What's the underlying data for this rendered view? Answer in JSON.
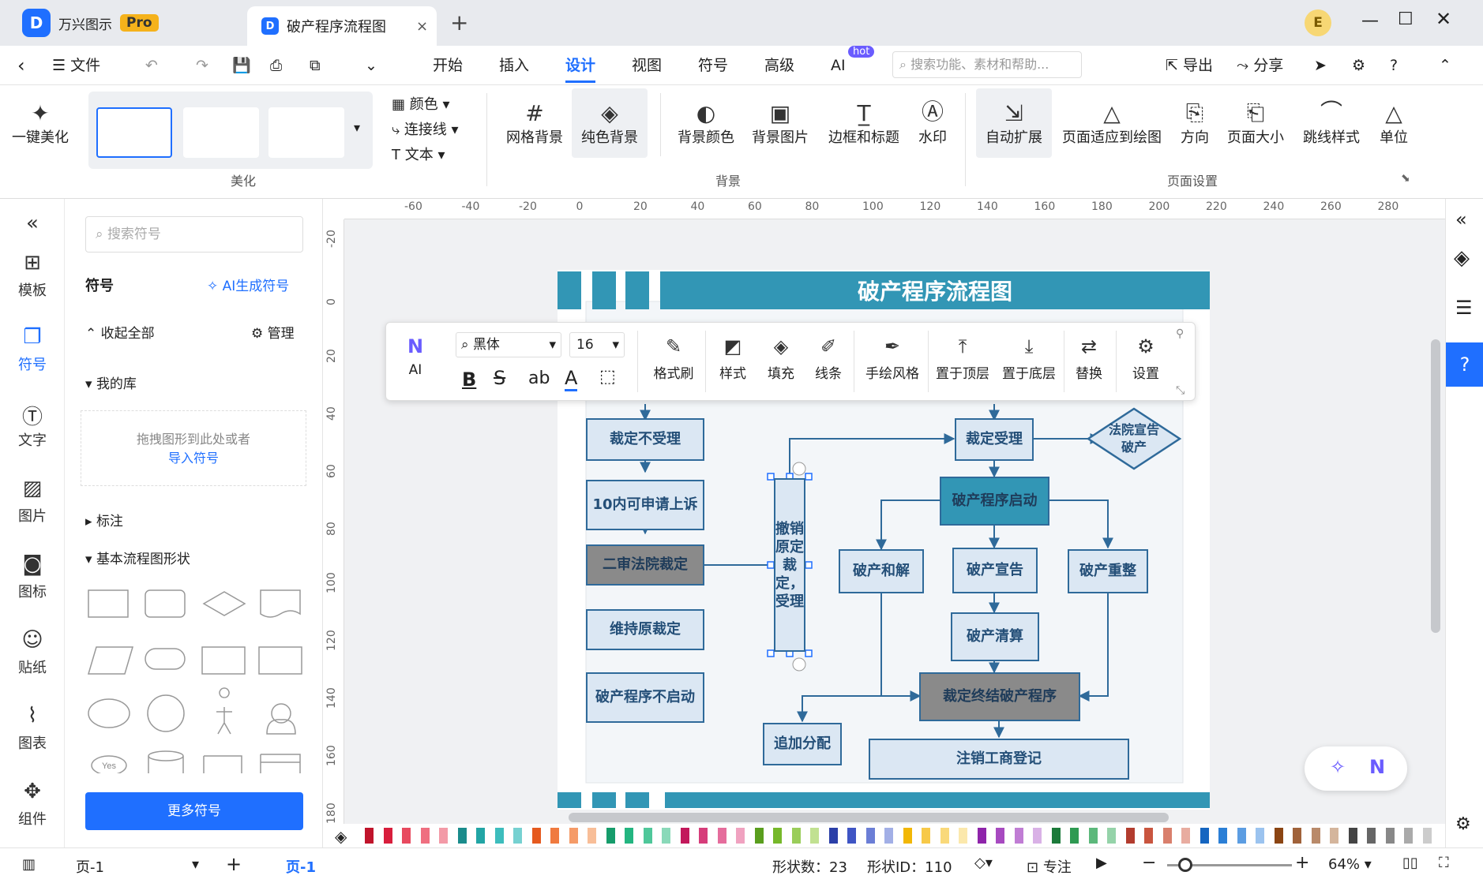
{
  "app": {
    "name": "万兴图示",
    "badge": "Pro",
    "doc_tab": "破产程序流程图",
    "new_tab": "+",
    "close_tab": "×",
    "user_initial": "E"
  },
  "menu": {
    "file": "文件",
    "tabs": [
      "开始",
      "插入",
      "设计",
      "视图",
      "符号",
      "高级",
      "AI"
    ],
    "active_tab": "设计",
    "ai_badge": "hot",
    "search_placeholder": "搜索功能、素材和帮助...",
    "export": "导出",
    "share": "分享"
  },
  "ribbon": {
    "beautify": {
      "one_click": "一键美化",
      "color": "颜色",
      "connector": "连接线",
      "text": "文本",
      "group": "美化"
    },
    "background": {
      "items": [
        "网格背景",
        "纯色背景",
        "背景颜色",
        "背景图片",
        "边框和标题",
        "水印"
      ],
      "group": "背景"
    },
    "page": {
      "items": [
        "自动扩展",
        "页面适应到绘图",
        "方向",
        "页面大小",
        "跳线样式",
        "单位"
      ],
      "group": "页面设置"
    }
  },
  "leftrail": [
    "模板",
    "符号",
    "文字",
    "图片",
    "图标",
    "贴纸",
    "图表",
    "组件"
  ],
  "panel": {
    "search_placeholder": "搜索符号",
    "title": "符号",
    "ai_gen": "AI生成符号",
    "collapse": "收起全部",
    "manage": "管理",
    "my_lib": "我的库",
    "drop_hint": "拖拽图形到此处或者",
    "import": "导入符号",
    "annot": "标注",
    "basic": "基本流程图形状",
    "more": "更多符号",
    "yes_label": "Yes"
  },
  "ruler": {
    "h": [
      "-60",
      "-40",
      "-20",
      "0",
      "20",
      "40",
      "60",
      "80",
      "100",
      "120",
      "140",
      "160",
      "180",
      "200",
      "220",
      "240",
      "260",
      "280"
    ],
    "v": [
      "-20",
      "0",
      "20",
      "40",
      "60",
      "80",
      "100",
      "120",
      "140",
      "160",
      "180"
    ]
  },
  "floatbar": {
    "ai": "AI",
    "font": "黑体",
    "size": "16",
    "items": [
      "格式刷",
      "样式",
      "填充",
      "线条",
      "手绘风格",
      "置于顶层",
      "置于底层",
      "替换",
      "设置"
    ]
  },
  "diagram": {
    "title": "破产程序流程图",
    "nodes": {
      "n1": "裁定不受理",
      "n2": "10内可申请上诉",
      "n3": "二审法院裁定",
      "n4": "维持原裁定",
      "n5": "破产程序不启动",
      "n6": "撤销原定裁定，受理",
      "n7": "裁定受理",
      "n8": "法院宣告破产",
      "n9": "破产程序启动",
      "n10": "破产和解",
      "n11": "破产宣告",
      "n12": "破产重整",
      "n13": "破产清算",
      "n14": "裁定终结破产程序",
      "n15": "追加分配",
      "n16": "注销工商登记"
    }
  },
  "status": {
    "page_sel": "页-1",
    "page_tab": "页-1",
    "shapes": "形状数：23",
    "shape_id": "形状ID：110",
    "focus": "专注",
    "zoom": "64%"
  },
  "colors": {
    "accent": "#1f6fff",
    "teal": "#3296b5",
    "node_border": "#2f6a9a"
  }
}
